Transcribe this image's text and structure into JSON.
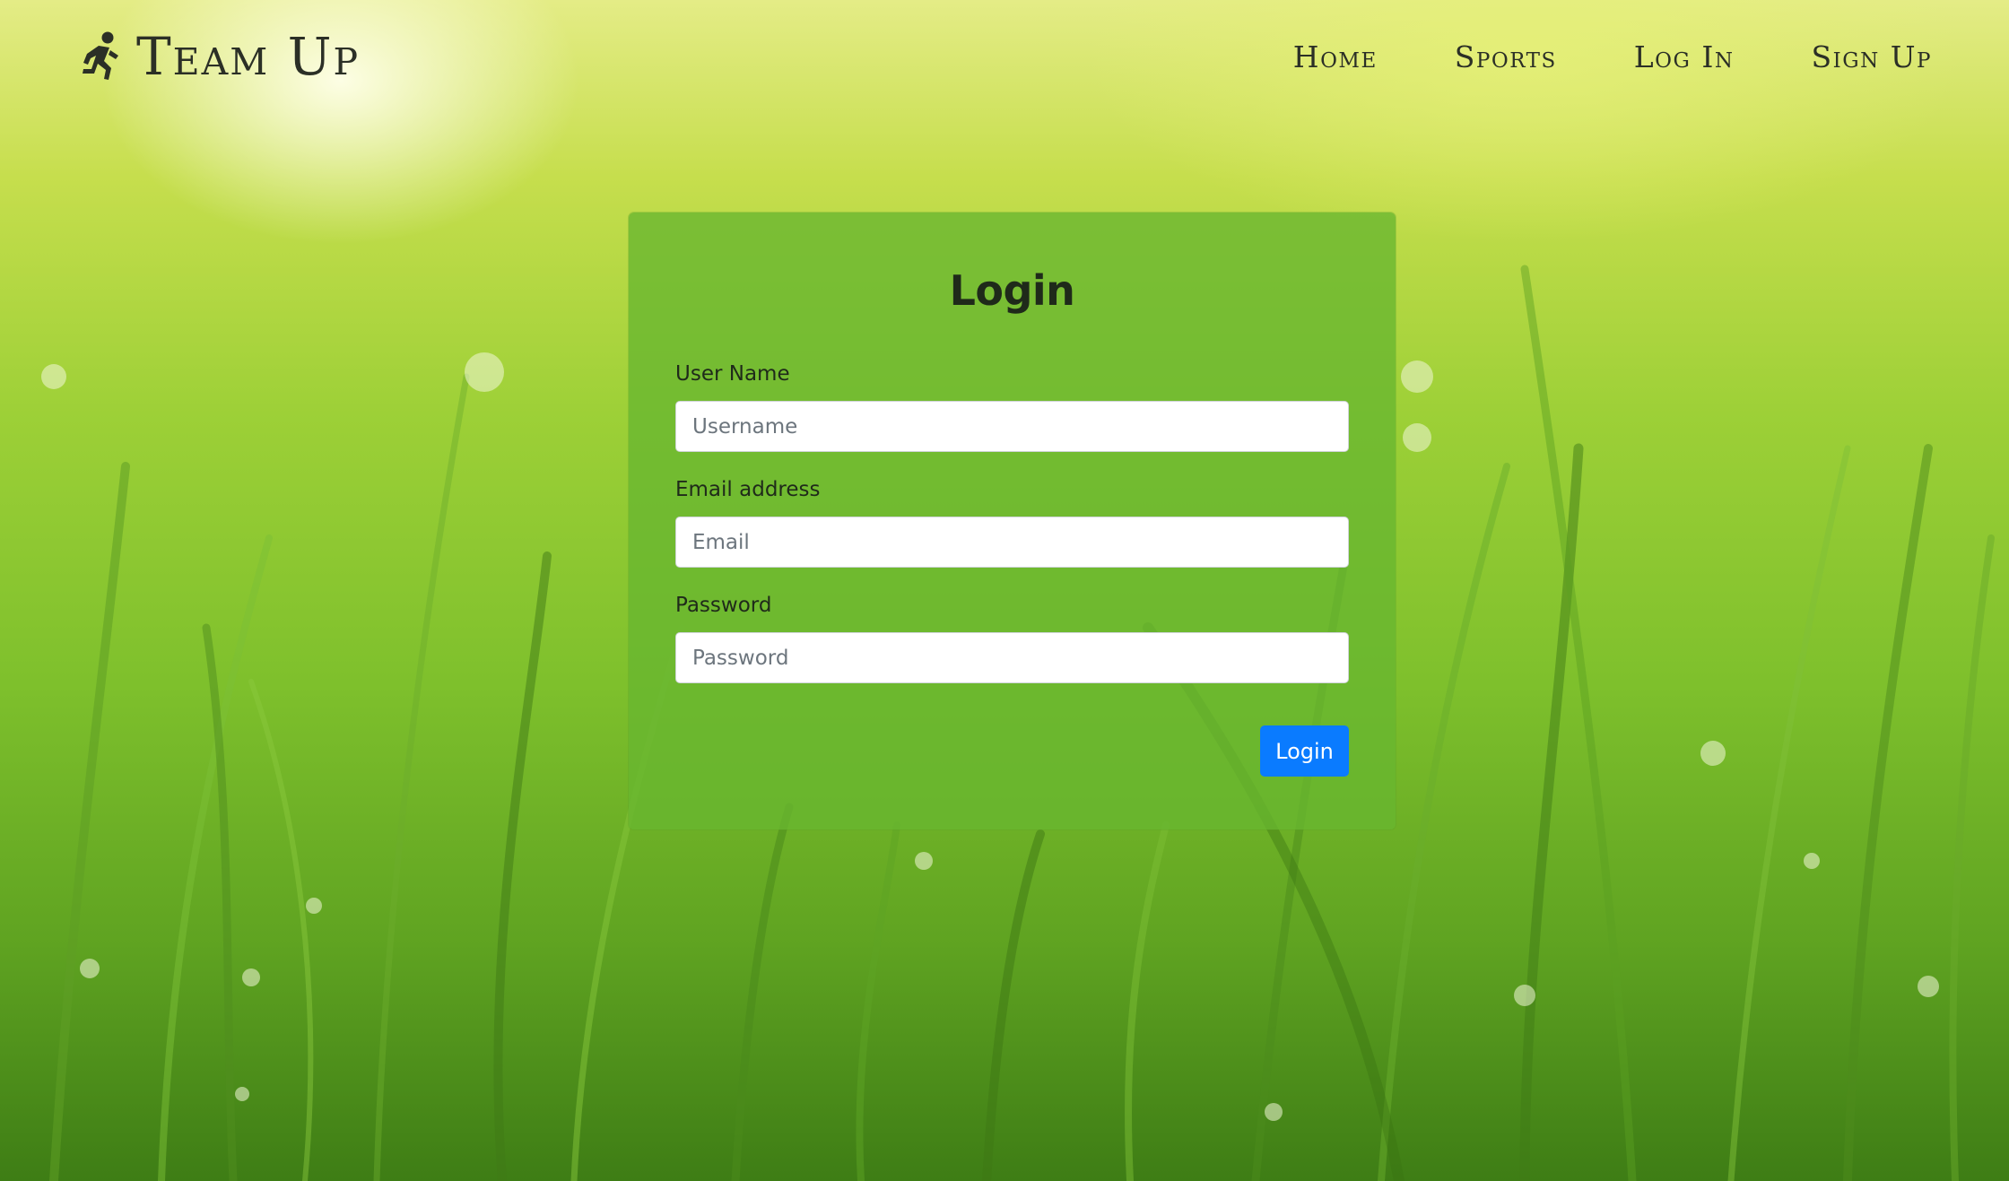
{
  "brand": {
    "name": "Team Up",
    "icon": "running-person-icon"
  },
  "nav": {
    "items": [
      {
        "label": "Home"
      },
      {
        "label": "Sports"
      },
      {
        "label": "Log In"
      },
      {
        "label": "Sign Up"
      }
    ]
  },
  "login_form": {
    "title": "Login",
    "username": {
      "label": "User Name",
      "placeholder": "Username",
      "value": ""
    },
    "email": {
      "label": "Email address",
      "placeholder": "Email",
      "value": ""
    },
    "password": {
      "label": "Password",
      "placeholder": "Password",
      "value": ""
    },
    "submit_label": "Login"
  },
  "colors": {
    "accent": "#0a7bff",
    "card_background": "#68b630",
    "text": "#2b2f26"
  },
  "background": {
    "description_icon": "grass-background"
  }
}
